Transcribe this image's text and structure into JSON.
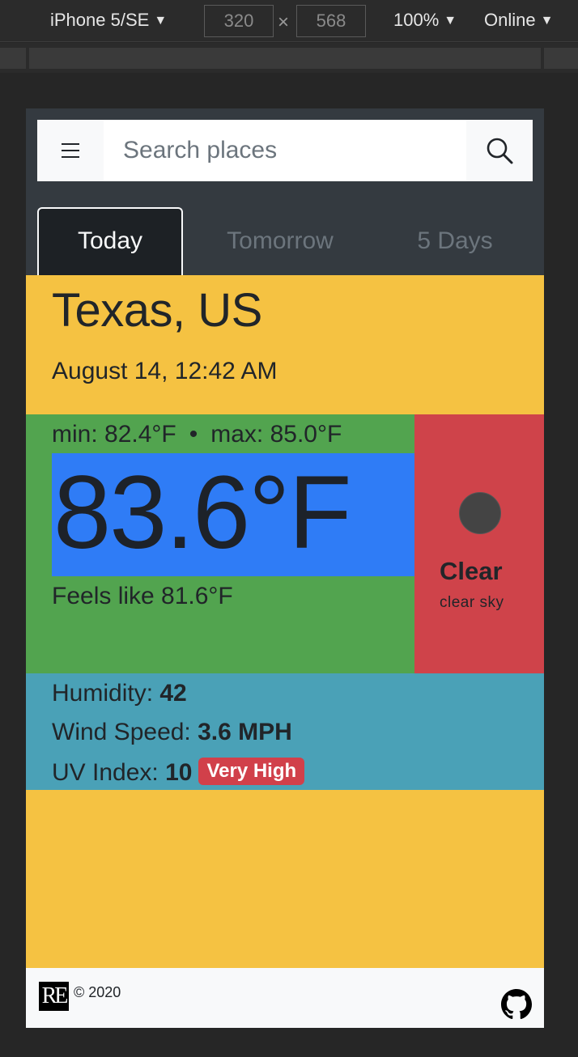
{
  "devtools": {
    "device": "iPhone 5/SE",
    "width": "320",
    "height": "568",
    "times": "×",
    "zoom": "100%",
    "network": "Online",
    "caret": "▼"
  },
  "navbar": {
    "search_placeholder": "Search places",
    "menu_icon": "hamburger-icon",
    "search_icon": "search-icon"
  },
  "tabs": [
    {
      "label": "Today",
      "active": true
    },
    {
      "label": "Tomorrow",
      "active": false
    },
    {
      "label": "5 Days",
      "active": false
    }
  ],
  "location": {
    "title": "Texas, US",
    "datetime": "August 14, 12:42 AM"
  },
  "temperature": {
    "min": "min: 82.4°F",
    "separator": "•",
    "max": "max: 85.0°F",
    "current": "83.6°F",
    "feels_like": "Feels like 81.6°F"
  },
  "condition": {
    "icon": "weather-icon",
    "main": "Clear",
    "description": "clear sky"
  },
  "details": {
    "humidity_label": "Humidity: ",
    "humidity_value": "42",
    "wind_label": "Wind Speed: ",
    "wind_value": "3.6 MPH",
    "uv_label": "UV Index: ",
    "uv_value": "10",
    "uv_badge": "Very High"
  },
  "footer": {
    "logo_text": "RE",
    "copyright": "© 2020",
    "github_icon": "github-icon"
  },
  "colors": {
    "navbar": "#343a40",
    "location_bg": "#f5c242",
    "temp_bg": "#52a44f",
    "temp_highlight": "#2f7cf6",
    "condition_bg": "#cf434a",
    "details_bg": "#4aa1b7",
    "badge_danger": "#d1404a"
  }
}
